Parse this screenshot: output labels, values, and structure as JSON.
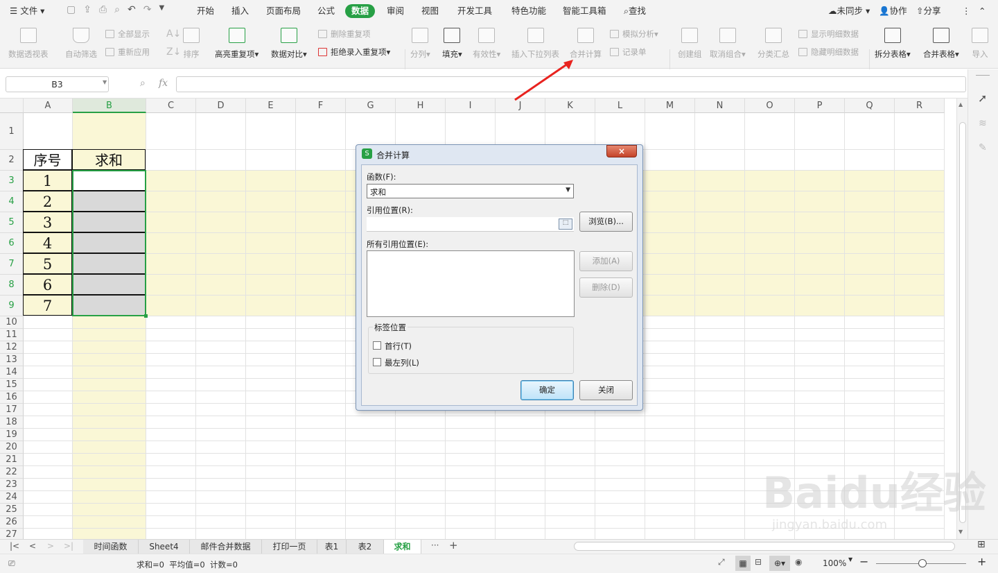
{
  "menubar": {
    "file_label": "文件",
    "tabs": [
      "开始",
      "插入",
      "页面布局",
      "公式",
      "数据",
      "审阅",
      "视图",
      "开发工具",
      "特色功能",
      "智能工具箱"
    ],
    "active_tab": "数据",
    "search_label": "查找",
    "sync_label": "未同步",
    "collab_label": "协作",
    "share_label": "分享"
  },
  "ribbon": {
    "pivot": "数据透视表",
    "auto_filter": "自动筛选",
    "show_all": "全部显示",
    "reapply": "重新应用",
    "sort": "排序",
    "highlight_dup": "高亮重复项",
    "data_compare": "数据对比",
    "remove_dup": "删除重复项",
    "reject_dup": "拒绝录入重复项",
    "split": "分列",
    "fill": "填充",
    "validity": "有效性",
    "insert_dropdown": "插入下拉列表",
    "consolidate": "合并计算",
    "simulate": "模拟分析",
    "record": "记录单",
    "create_group": "创建组",
    "ungroup": "取消组合",
    "subtotal": "分类汇总",
    "show_detail": "显示明细数据",
    "hide_detail": "隐藏明细数据",
    "split_table": "拆分表格",
    "merge_table": "合并表格",
    "import": "导入"
  },
  "formula_bar": {
    "name_box": "B3",
    "fx": "fx",
    "value": ""
  },
  "columns": [
    "A",
    "B",
    "C",
    "D",
    "E",
    "F",
    "G",
    "H",
    "I",
    "J",
    "K",
    "L",
    "M",
    "N",
    "O",
    "P",
    "Q",
    "R"
  ],
  "rows": [
    "1",
    "2",
    "3",
    "4",
    "5",
    "6",
    "7",
    "8",
    "9",
    "10",
    "11",
    "12",
    "13",
    "14",
    "15",
    "16",
    "17",
    "18",
    "19",
    "20",
    "21",
    "22",
    "23",
    "24",
    "25",
    "26",
    "27"
  ],
  "table": {
    "header_a": "序号",
    "header_b": "求和",
    "values": [
      "1",
      "2",
      "3",
      "4",
      "5",
      "6",
      "7"
    ]
  },
  "dialog": {
    "title": "合并计算",
    "function_label": "函数(F):",
    "function_value": "求和",
    "ref_label": "引用位置(R):",
    "browse": "浏览(B)...",
    "all_refs_label": "所有引用位置(E):",
    "add": "添加(A)",
    "delete": "删除(D)",
    "label_pos": "标签位置",
    "first_row": "首行(T)",
    "left_col": "最左列(L)",
    "ok": "确定",
    "close": "关闭"
  },
  "sheet_tabs": [
    "时间函数",
    "Sheet4",
    "邮件合并数据",
    "打印一页",
    "表1",
    "表2",
    "求和"
  ],
  "active_sheet": "求和",
  "status": {
    "text": "求和=0  平均值=0  计数=0",
    "zoom": "100%"
  },
  "watermark": {
    "brand": "Baidu经验",
    "url": "jingyan.baidu.com"
  },
  "colors": {
    "accent": "#27a045",
    "highlight_row": "#faf7d6",
    "arrow": "#e8231f"
  }
}
